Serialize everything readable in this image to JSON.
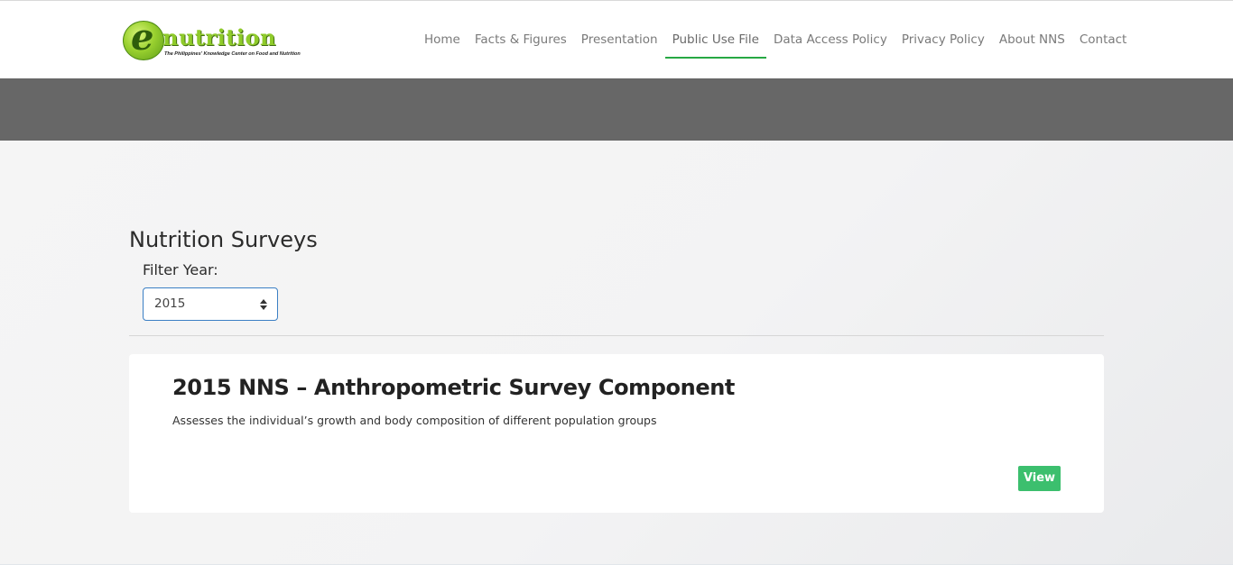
{
  "header": {
    "logo": {
      "letter": "e",
      "word": "nutrition",
      "tagline": "The Philippines' Knowledge Center on Food and Nutrition"
    },
    "nav": [
      {
        "label": "Home",
        "active": false
      },
      {
        "label": "Facts & Figures",
        "active": false
      },
      {
        "label": "Presentation",
        "active": false
      },
      {
        "label": "Public Use File",
        "active": true
      },
      {
        "label": "Data Access Policy",
        "active": false
      },
      {
        "label": "Privacy Policy",
        "active": false
      },
      {
        "label": "About NNS",
        "active": false
      },
      {
        "label": "Contact",
        "active": false
      }
    ]
  },
  "main": {
    "title": "Nutrition Surveys",
    "filter": {
      "label": "Filter Year:",
      "selected": "2015",
      "icon": "select-caret-icon"
    },
    "card": {
      "title": "2015 NNS – Anthropometric Survey Component",
      "description": "Assesses the individual’s growth and body composition of different population groups",
      "button_label": "View"
    }
  },
  "colors": {
    "accent_green": "#27a844",
    "button_green": "#3cbf6e",
    "banner_gray": "#676767",
    "select_border": "#3b7fc4"
  }
}
